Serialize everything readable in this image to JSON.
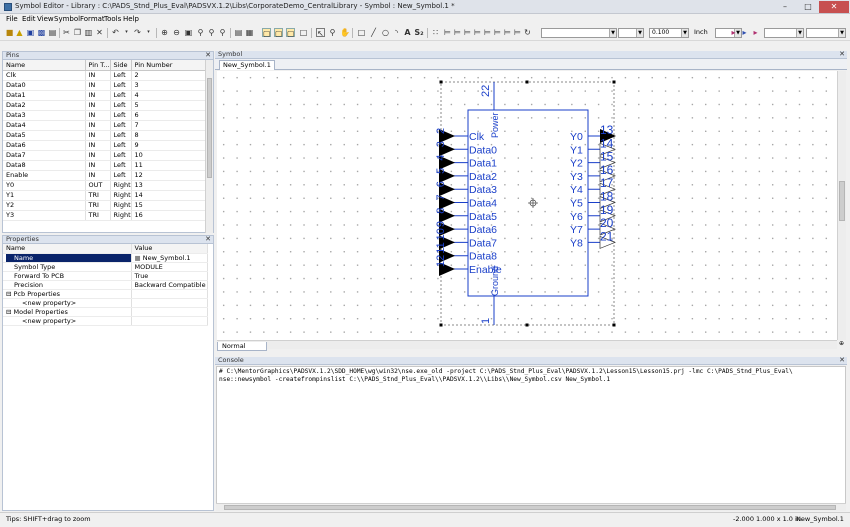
{
  "window": {
    "title": "Symbol Editor - Library : C:\\PADS_Stnd_Plus_Eval\\PADSVX.1.2\\Libs\\CorporateDemo_CentralLibrary - Symbol : New_Symbol.1 *"
  },
  "menu": [
    "File",
    "Edit",
    "View",
    "Symbol",
    "Format",
    "Tools",
    "Help"
  ],
  "toolbar": {
    "line_width": "0.100",
    "units": "Inch",
    "style_combo": "",
    "font_combo": ""
  },
  "pins_panel": {
    "title": "Pins",
    "columns": [
      "Name",
      "Pin T...",
      "Side",
      "Pin Number"
    ],
    "rows": [
      [
        "Clk",
        "IN",
        "Left",
        "2"
      ],
      [
        "Data0",
        "IN",
        "Left",
        "3"
      ],
      [
        "Data1",
        "IN",
        "Left",
        "4"
      ],
      [
        "Data2",
        "IN",
        "Left",
        "5"
      ],
      [
        "Data3",
        "IN",
        "Left",
        "6"
      ],
      [
        "Data4",
        "IN",
        "Left",
        "7"
      ],
      [
        "Data5",
        "IN",
        "Left",
        "8"
      ],
      [
        "Data6",
        "IN",
        "Left",
        "9"
      ],
      [
        "Data7",
        "IN",
        "Left",
        "10"
      ],
      [
        "Data8",
        "IN",
        "Left",
        "11"
      ],
      [
        "Enable",
        "IN",
        "Left",
        "12"
      ],
      [
        "Y0",
        "OUT",
        "Right",
        "13"
      ],
      [
        "Y1",
        "TRI",
        "Right",
        "14"
      ],
      [
        "Y2",
        "TRI",
        "Right",
        "15"
      ],
      [
        "Y3",
        "TRI",
        "Right",
        "16"
      ]
    ]
  },
  "properties_panel": {
    "title": "Properties",
    "columns": [
      "Name",
      "Value"
    ],
    "rows": [
      {
        "name": "Name",
        "value": "New_Symbol.1",
        "indent": 1,
        "selected": true
      },
      {
        "name": "Symbol Type",
        "value": "MODULE",
        "indent": 1
      },
      {
        "name": "Forward To PCB",
        "value": "True",
        "indent": 1
      },
      {
        "name": "Precision",
        "value": "Backward Compatible",
        "indent": 1
      },
      {
        "name": "Pcb Properties",
        "value": "",
        "indent": 0,
        "group": true
      },
      {
        "name": "<new property>",
        "value": "",
        "indent": 2
      },
      {
        "name": "Model Properties",
        "value": "",
        "indent": 0,
        "group": true
      },
      {
        "name": "<new property>",
        "value": "",
        "indent": 2
      }
    ]
  },
  "symbol_panel": {
    "title": "Symbol",
    "tab": "New_Symbol.1",
    "bottom_tab": "Normal",
    "top_pin": {
      "number": "22",
      "name": "Power"
    },
    "bottom_pin": {
      "number": "1",
      "name": "Ground"
    },
    "left_pins": [
      {
        "name": "Clk",
        "number": "2"
      },
      {
        "name": "Data0",
        "number": "3"
      },
      {
        "name": "Data1",
        "number": "4"
      },
      {
        "name": "Data2",
        "number": "5"
      },
      {
        "name": "Data3",
        "number": "6"
      },
      {
        "name": "Data4",
        "number": "7"
      },
      {
        "name": "Data5",
        "number": "8"
      },
      {
        "name": "Data6",
        "number": "9"
      },
      {
        "name": "Data7",
        "number": "10"
      },
      {
        "name": "Data8",
        "number": "11"
      },
      {
        "name": "Enable",
        "number": "12"
      }
    ],
    "right_pins": [
      {
        "name": "Y0",
        "number": "13"
      },
      {
        "name": "Y1",
        "number": "14"
      },
      {
        "name": "Y2",
        "number": "15"
      },
      {
        "name": "Y3",
        "number": "16"
      },
      {
        "name": "Y4",
        "number": "17"
      },
      {
        "name": "Y5",
        "number": "18"
      },
      {
        "name": "Y6",
        "number": "19"
      },
      {
        "name": "Y7",
        "number": "20"
      },
      {
        "name": "Y8",
        "number": "21"
      }
    ],
    "symbol_color": "#1a3fc9"
  },
  "console": {
    "title": "Console",
    "lines": [
      "# C:\\MentorGraphics\\PADSVX.1.2\\SDD_HOME\\wg\\win32\\nse.exe_old -project C:\\PADS_Stnd_Plus_Eval\\PADSVX.1.2\\Lesson15\\Lesson15.prj -lmc C:\\PADS_Stnd_Plus_Eval\\",
      "nse::newsymbol -createfrompinslist C:\\\\PADS_Stnd_Plus_Eval\\\\PADSVX.1.2\\\\Libs\\\\New_Symbol.csv New_Symbol.1"
    ]
  },
  "status": {
    "tip": "Tips: SHIFT+drag to zoom",
    "coords": "-2.000 1.000 x 1.0 in.",
    "symbol": "New_Symbol.1"
  }
}
